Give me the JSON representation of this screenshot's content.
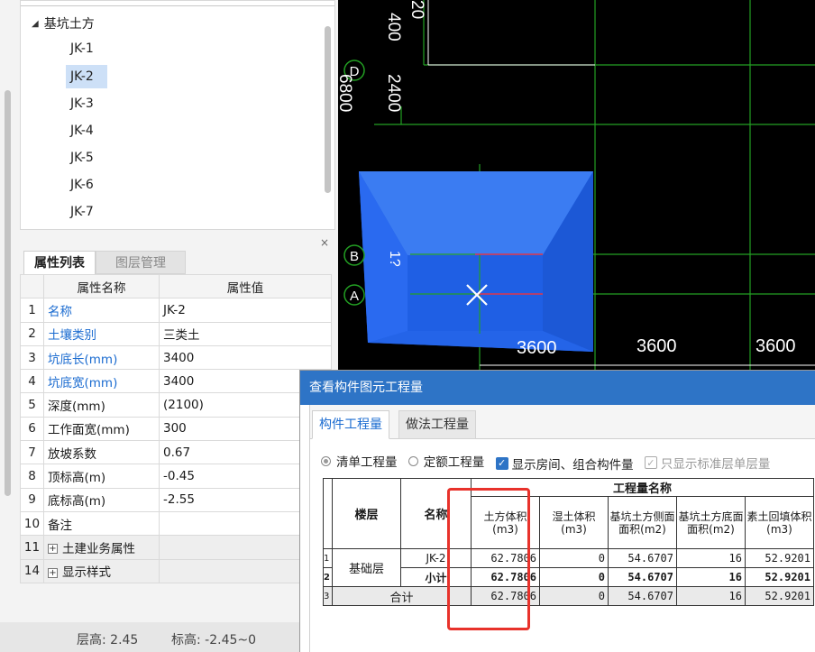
{
  "tree": {
    "root_label": "基坑土方",
    "items": [
      "JK-1",
      "JK-2",
      "JK-3",
      "JK-4",
      "JK-5",
      "JK-6",
      "JK-7"
    ],
    "selected": "JK-2"
  },
  "prop_panel": {
    "close_glyph": "×",
    "tabs": [
      "属性列表",
      "图层管理"
    ],
    "headers": [
      "属性名称",
      "属性值"
    ],
    "rows": [
      {
        "num": "1",
        "name": "名称",
        "value": "JK-2"
      },
      {
        "num": "2",
        "name": "土壤类别",
        "value": "三类土"
      },
      {
        "num": "3",
        "name": "坑底长(mm)",
        "value": "3400"
      },
      {
        "num": "4",
        "name": "坑底宽(mm)",
        "value": "3400"
      },
      {
        "num": "5",
        "name": "深度(mm)",
        "value": "(2100)"
      },
      {
        "num": "6",
        "name": "工作面宽(mm)",
        "value": "300"
      },
      {
        "num": "7",
        "name": "放坡系数",
        "value": "0.67"
      },
      {
        "num": "8",
        "name": "顶标高(m)",
        "value": "-0.45"
      },
      {
        "num": "9",
        "name": "底标高(m)",
        "value": "-2.55"
      },
      {
        "num": "10",
        "name": "备注",
        "value": ""
      },
      {
        "num": "11",
        "name": "土建业务属性",
        "value": ""
      },
      {
        "num": "14",
        "name": "显示样式",
        "value": ""
      }
    ]
  },
  "status": {
    "floor_height": "层高:  2.45",
    "elevation": "标高:  -2.45~0"
  },
  "cad": {
    "axis_labels": [
      "D",
      "B",
      "A"
    ],
    "dim_texts": [
      "400",
      "20",
      "2400",
      "6800",
      "3600",
      "3600",
      "3600",
      "1?"
    ]
  },
  "dialog": {
    "title": "查看构件图元工程量",
    "tabs": [
      "构件工程量",
      "做法工程量"
    ],
    "options": [
      {
        "label": "清单工程量",
        "type": "radio",
        "checked": true
      },
      {
        "label": "定额工程量",
        "type": "radio",
        "checked": false
      },
      {
        "label": "显示房间、组合构件量",
        "type": "checkbox",
        "checked": true
      },
      {
        "label": "只显示标准层单层量",
        "type": "checkbox",
        "checked": true,
        "disabled": true
      }
    ],
    "table": {
      "group_header": "工程量名称",
      "col_floor": "楼层",
      "col_name": "名称",
      "qty_columns": [
        "土方体积(m3)",
        "湿土体积(m3)",
        "基坑土方侧面面积(m2)",
        "基坑土方底面面积(m2)",
        "素土回填体积(m3)"
      ],
      "floor_value": "基础层",
      "rows": [
        {
          "idx": "1",
          "name": "JK-2",
          "values": [
            "62.7806",
            "0",
            "54.6707",
            "16",
            "52.9201"
          ]
        },
        {
          "idx": "2",
          "name": "小计",
          "values": [
            "62.7806",
            "0",
            "54.6707",
            "16",
            "52.9201"
          ]
        },
        {
          "idx": "3",
          "name": "合计",
          "values": [
            "62.7806",
            "0",
            "54.6707",
            "16",
            "52.9201"
          ]
        }
      ]
    }
  },
  "colors": {
    "accent": "#2e74c6",
    "grid_line": "#23a023",
    "pit_blue": "#1f62e6",
    "highlight": "#e8322b"
  }
}
